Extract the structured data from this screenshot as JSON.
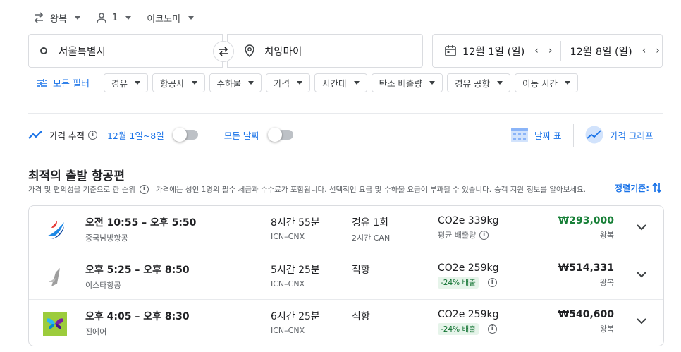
{
  "search": {
    "trip_type": "왕복",
    "passengers": "1",
    "cabin": "이코노미",
    "origin": "서울특별시",
    "destination": "치앙마이",
    "depart_date": "12월 1일 (일)",
    "return_date": "12월 8일 (일)"
  },
  "filters": {
    "all_label": "모든 필터",
    "chips": [
      "경유",
      "항공사",
      "수하물",
      "가격",
      "시간대",
      "탄소 배출량",
      "경유 공항",
      "이동 시간"
    ]
  },
  "tracking": {
    "label": "가격 추적",
    "range": "12월 1일~8일",
    "all_dates": "모든 날짜",
    "date_grid": "날짜 표",
    "price_graph": "가격 그래프"
  },
  "results": {
    "title": "최적의 출발 항공편",
    "subtitle_left": "가격 및 편의성을 기준으로 한 순위",
    "subtitle_mid": "가격에는 성인 1명의 필수 세금과 수수료가 포함됩니다. 선택적인 요금 및",
    "subtitle_link1": "수하물 요금",
    "subtitle_mid2": "이 부과될 수 있습니다.",
    "subtitle_link2": "승객 지원",
    "subtitle_end": "정보를 알아보세요.",
    "sort_label": "정렬기준:",
    "flights": [
      {
        "times": "오전 10:55 – 오후 5:50",
        "airline": "중국남방항공",
        "duration": "8시간 55분",
        "route": "ICN–CNX",
        "stops": "경유 1회",
        "stop_detail": "2시간 CAN",
        "co2": "CO2e 339kg",
        "co2_note": "평균 배출량",
        "co2_badge": "",
        "price": "₩293,000",
        "price_type": "왕복",
        "price_color": "#188038"
      },
      {
        "times": "오후 5:25 – 오후 8:50",
        "airline": "이스타항공",
        "duration": "5시간 25분",
        "route": "ICN–CNX",
        "stops": "직항",
        "stop_detail": "",
        "co2": "CO2e 259kg",
        "co2_note": "",
        "co2_badge": "-24% 배출",
        "price": "₩514,331",
        "price_type": "왕복",
        "price_color": "#202124"
      },
      {
        "times": "오후 4:05 – 오후 8:30",
        "airline": "진에어",
        "duration": "6시간 25분",
        "route": "ICN–CNX",
        "stops": "직항",
        "stop_detail": "",
        "co2": "CO2e 259kg",
        "co2_note": "",
        "co2_badge": "-24% 배출",
        "price": "₩540,600",
        "price_type": "왕복",
        "price_color": "#202124"
      }
    ]
  },
  "colors": {
    "accent": "#1a73e8",
    "good_price": "#188038",
    "badge_bg": "#e6f4ea"
  }
}
